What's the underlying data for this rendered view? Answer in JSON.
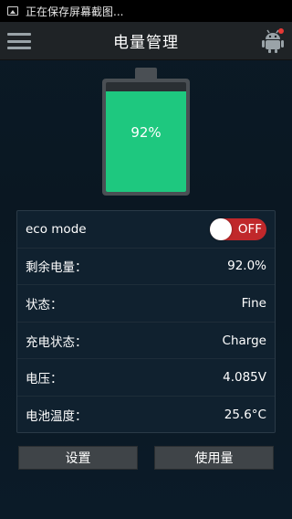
{
  "status_bar": {
    "icon": "screenshot-icon",
    "text": "正在保存屏幕截图..."
  },
  "header": {
    "title": "电量管理",
    "menu_icon": "hamburger-menu-icon",
    "robot_icon": "android-robot-icon",
    "notification_dot_color": "#e53935"
  },
  "battery": {
    "level_fraction": 0.92,
    "label": "92%",
    "fill_color": "#1ec87f"
  },
  "info": {
    "eco_mode": {
      "label": "eco mode",
      "toggle_text": "OFF",
      "toggle_color": "#c0282b"
    },
    "rows": [
      {
        "label": "剩余电量：",
        "value": "92.0%"
      },
      {
        "label": "状态：",
        "value": "Fine"
      },
      {
        "label": "充电状态：",
        "value": "Charge"
      },
      {
        "label": "电压：",
        "value": "4.085V"
      },
      {
        "label": "电池温度：",
        "value": "25.6°C"
      }
    ]
  },
  "buttons": {
    "settings": "设置",
    "usage": "使用量"
  }
}
